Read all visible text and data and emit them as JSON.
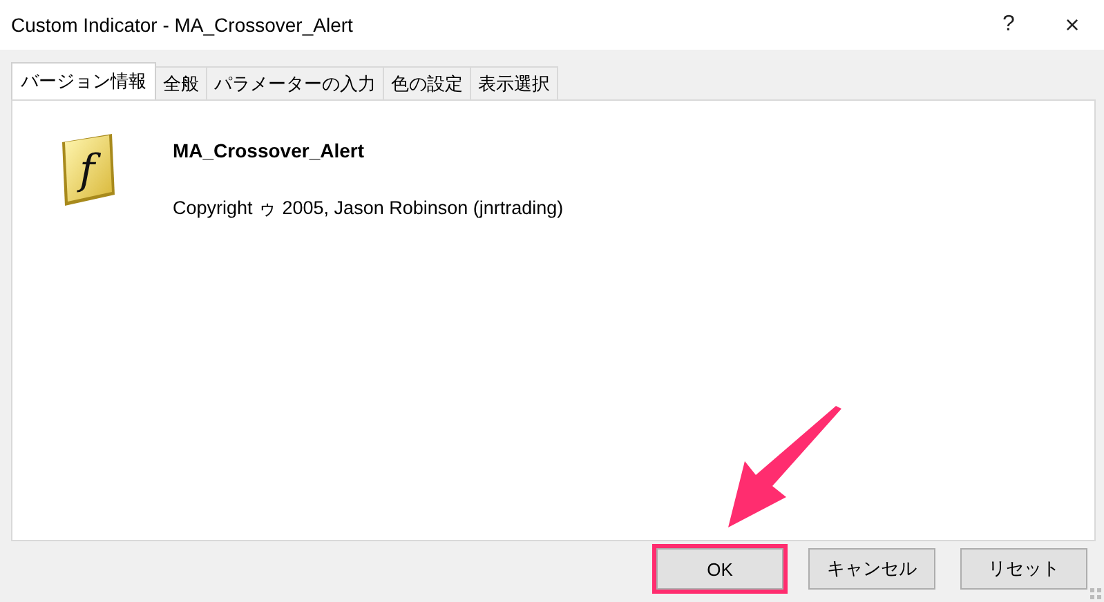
{
  "window": {
    "title": "Custom Indicator - MA_Crossover_Alert",
    "help": "?",
    "close": "×"
  },
  "tabs": [
    {
      "label": "バージョン情報",
      "selected": true
    },
    {
      "label": "全般",
      "selected": false
    },
    {
      "label": "パラメーターの入力",
      "selected": false
    },
    {
      "label": "色の設定",
      "selected": false
    },
    {
      "label": "表示選択",
      "selected": false
    }
  ],
  "info": {
    "icon_letter": "f",
    "name": "MA_Crossover_Alert",
    "copyright": "Copyright ゥ 2005, Jason Robinson (jnrtrading)"
  },
  "buttons": [
    {
      "label": "OK",
      "highlighted": true
    },
    {
      "label": "キャンセル",
      "highlighted": false
    },
    {
      "label": "リセット",
      "highlighted": false
    }
  ]
}
